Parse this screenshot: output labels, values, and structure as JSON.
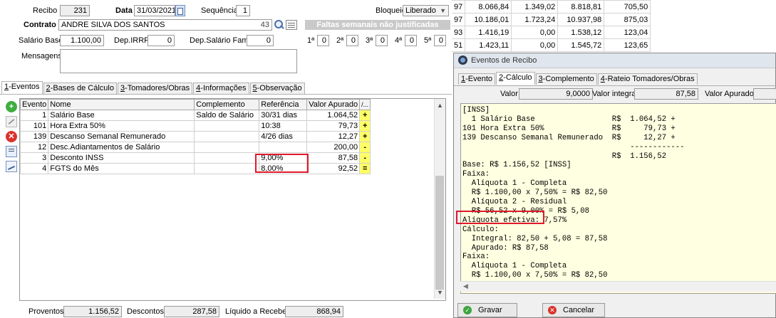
{
  "header": {
    "recibo_label": "Recibo",
    "recibo_value": "231",
    "data_label": "Data",
    "data_value": "31/03/2021",
    "sequencia_label": "Sequência",
    "sequencia_value": "1",
    "bloqueio_label": "Bloqueio",
    "bloqueio_value": "Liberado",
    "contrato_label": "Contrato",
    "contrato_value": "ANDRE SILVA DOS SANTOS",
    "contrato_code": "43",
    "salario_label": "Salário Base",
    "salario_value": "1.100,00",
    "depirrf_label": "Dep.IRRF",
    "depirrf_value": "0",
    "depsal_label": "Dep.Salário Fam.",
    "depsal_value": "0",
    "mensagens_label": "Mensagens",
    "faltas_title": "Faltas semanais não justificadas",
    "faltas": [
      {
        "label": "1ª",
        "value": "0"
      },
      {
        "label": "2ª",
        "value": "0"
      },
      {
        "label": "3ª",
        "value": "0"
      },
      {
        "label": "4ª",
        "value": "0"
      },
      {
        "label": "5ª",
        "value": "0"
      }
    ]
  },
  "tabs": [
    {
      "key": "1",
      "label": "-Eventos"
    },
    {
      "key": "2",
      "label": "-Bases de Cálculo"
    },
    {
      "key": "3",
      "label": "-Tomadores/Obras"
    },
    {
      "key": "4",
      "label": "-Informações"
    },
    {
      "key": "5",
      "label": "-Observação"
    }
  ],
  "grid": {
    "headers": {
      "evento": "Evento",
      "nome": "Nome",
      "complemento": "Complemento",
      "referencia": "Referência",
      "valor": "Valor Apurado",
      "sign": "/..."
    },
    "rows": [
      {
        "evento": "1",
        "nome": "Salário Base",
        "complemento": "Saldo de Salário",
        "referencia": "30/31 dias",
        "valor": "1.064,52",
        "sign": "+"
      },
      {
        "evento": "101",
        "nome": "Hora Extra 50%",
        "complemento": "",
        "referencia": "10:38",
        "valor": "79,73",
        "sign": "+"
      },
      {
        "evento": "139",
        "nome": "Descanso Semanal Remunerado",
        "complemento": "",
        "referencia": "4/26 dias",
        "valor": "12,27",
        "sign": "+"
      },
      {
        "evento": "12",
        "nome": "Desc.Adiantamentos de Salário",
        "complemento": "",
        "referencia": "",
        "valor": "200,00",
        "sign": "-"
      },
      {
        "evento": "3",
        "nome": "Desconto INSS",
        "complemento": "",
        "referencia": "9,00%",
        "valor": "87,58",
        "sign": "-"
      },
      {
        "evento": "4",
        "nome": "FGTS do Mês",
        "complemento": "",
        "referencia": "8,00%",
        "valor": "92,52",
        "sign": "="
      }
    ]
  },
  "footer": {
    "proventos_label": "Proventos",
    "proventos_value": "1.156,52",
    "descontos_label": "Descontos",
    "descontos_value": "287,58",
    "liquido_label": "Líquido a Receber",
    "liquido_value": "868,94"
  },
  "bg_table": [
    [
      "97",
      "8.066,84",
      "1.349,02",
      "8.818,81",
      "705,50"
    ],
    [
      "97",
      "10.186,01",
      "1.723,24",
      "10.937,98",
      "875,03"
    ],
    [
      "93",
      "1.416,19",
      "0,00",
      "1.538,12",
      "123,04"
    ],
    [
      "51",
      "1.423,11",
      "0,00",
      "1.545,72",
      "123,65"
    ]
  ],
  "popup": {
    "title": "Eventos de Recibo",
    "tabs": [
      {
        "key": "1",
        "label": "-Evento"
      },
      {
        "key": "2",
        "label": "-Cálculo"
      },
      {
        "key": "3",
        "label": "-Complemento"
      },
      {
        "key": "4",
        "label": "-Rateio Tomadores/Obras"
      }
    ],
    "valor_label": "Valor",
    "valor_value": "9,0000",
    "valor_integral_label": "Valor integral",
    "valor_integral_value": "87,58",
    "valor_apurado_label": "Valor Apurado",
    "calc_lines": [
      "[INSS]",
      "  1 Salário Base                 R$  1.064,52 +",
      "101 Hora Extra 50%               R$     79,73 +",
      "139 Descanso Semanal Remunerado  R$     12,27 +",
      "                                     ------------",
      "                                 R$  1.156,52",
      "Base: R$ 1.156,52 [INSS]",
      "Faixa:",
      "  Alíquota 1 - Completa",
      "  R$ 1.100,00 x 7,50% = R$ 82,50",
      "  Alíquota 2 - Residual",
      "  R$ 56,52 x 9,00% = R$ 5,08",
      "Alíquota efetiva: 7,57%",
      "Cálculo:",
      "  Integral: 82,50 + 5,08 = 87,58",
      "  Apurado: R$ 87,58",
      "Faixa:",
      "  Alíquota 1 - Completa",
      "  R$ 1.100,00 x 7,50% = R$ 82,50"
    ],
    "gravar_label": "Gravar",
    "cancelar_label": "Cancelar"
  }
}
